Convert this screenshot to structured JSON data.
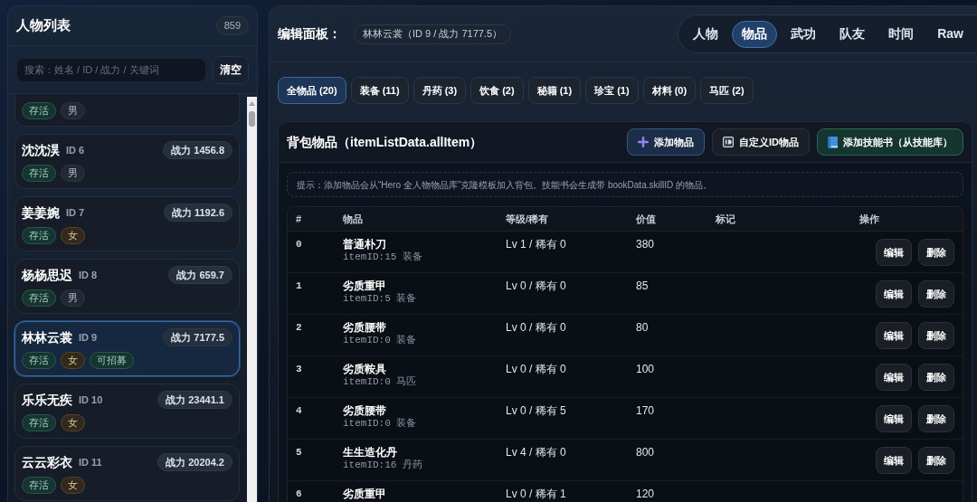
{
  "sidebar": {
    "title": "人物列表",
    "count": "859",
    "search": {
      "placeholder": "搜索：姓名 / ID / 战力 / 关键词"
    },
    "clear_button": "清空",
    "characters": [
      {
        "selected": false,
        "tags": [
          {
            "label": "存活",
            "kind": "status"
          },
          {
            "label": "男",
            "kind": "male"
          }
        ]
      },
      {
        "name": "沈沈淏",
        "id": "ID 6",
        "power": "战力 1456.8",
        "selected": false,
        "tags": [
          {
            "label": "存活",
            "kind": "status"
          },
          {
            "label": "男",
            "kind": "male"
          }
        ]
      },
      {
        "name": "姜姜婉",
        "id": "ID 7",
        "power": "战力 1192.6",
        "selected": false,
        "tags": [
          {
            "label": "存活",
            "kind": "status"
          },
          {
            "label": "女",
            "kind": "female"
          }
        ]
      },
      {
        "name": "杨杨思迟",
        "id": "ID 8",
        "power": "战力 659.7",
        "selected": false,
        "tags": [
          {
            "label": "存活",
            "kind": "status"
          },
          {
            "label": "男",
            "kind": "male"
          }
        ]
      },
      {
        "name": "林林云裳",
        "id": "ID 9",
        "power": "战力 7177.5",
        "selected": true,
        "tags": [
          {
            "label": "存活",
            "kind": "status"
          },
          {
            "label": "女",
            "kind": "female"
          },
          {
            "label": "可招募",
            "kind": "status"
          }
        ]
      },
      {
        "name": "乐乐无疾",
        "id": "ID 10",
        "power": "战力 23441.1",
        "selected": false,
        "tags": [
          {
            "label": "存活",
            "kind": "status"
          },
          {
            "label": "女",
            "kind": "female"
          }
        ]
      },
      {
        "name": "云云彩衣",
        "id": "ID 11",
        "power": "战力 20204.2",
        "selected": false,
        "tags": [
          {
            "label": "存活",
            "kind": "status"
          },
          {
            "label": "女",
            "kind": "female"
          }
        ]
      }
    ]
  },
  "editor": {
    "title": "编辑面板：",
    "current": "林林云裳（ID 9 / 战力 7177.5）",
    "tabs": [
      {
        "label": "人物",
        "selected": false
      },
      {
        "label": "物品",
        "selected": true
      },
      {
        "label": "武功",
        "selected": false
      },
      {
        "label": "队友",
        "selected": false
      },
      {
        "label": "时间",
        "selected": false
      },
      {
        "label": "Raw",
        "selected": false
      }
    ],
    "categories": [
      {
        "label": "全物品 (20)",
        "selected": true
      },
      {
        "label": "装备 (11)",
        "selected": false
      },
      {
        "label": "丹药 (3)",
        "selected": false
      },
      {
        "label": "饮食 (2)",
        "selected": false
      },
      {
        "label": "秘籍 (1)",
        "selected": false
      },
      {
        "label": "珍宝 (1)",
        "selected": false
      },
      {
        "label": "材料 (0)",
        "selected": false
      },
      {
        "label": "马匹 (2)",
        "selected": false
      }
    ],
    "backpack": {
      "title": "背包物品（itemListData.allItem）",
      "buttons": [
        {
          "label": "添加物品",
          "kind": "add"
        },
        {
          "label": "自定义ID物品",
          "kind": "custom"
        },
        {
          "label": "添加技能书（从技能库）",
          "kind": "book"
        }
      ],
      "hint": "提示：添加物品会从“Hero 全人物物品库”克隆模板加入背包。技能书会生成带 bookData.skillID 的物品。",
      "table": {
        "columns": [
          "#",
          "物品",
          "等级/稀有",
          "价值",
          "标记",
          "操作"
        ],
        "rows": [
          {
            "index": "0",
            "name": "普通朴刀",
            "sub": "itemID:15 装备",
            "level": "Lv 1 / 稀有 0",
            "value": "380",
            "actions": [
              "编辑",
              "删除"
            ]
          },
          {
            "index": "1",
            "name": "劣质重甲",
            "sub": "itemID:5 装备",
            "level": "Lv 0 / 稀有 0",
            "value": "85",
            "actions": [
              "编辑",
              "删除"
            ]
          },
          {
            "index": "2",
            "name": "劣质腰带",
            "sub": "itemID:0 装备",
            "level": "Lv 0 / 稀有 0",
            "value": "80",
            "actions": [
              "编辑",
              "删除"
            ]
          },
          {
            "index": "3",
            "name": "劣质鞍具",
            "sub": "itemID:0 马匹",
            "level": "Lv 0 / 稀有 0",
            "value": "100",
            "actions": [
              "编辑",
              "删除"
            ]
          },
          {
            "index": "4",
            "name": "劣质腰带",
            "sub": "itemID:0 装备",
            "level": "Lv 0 / 稀有 5",
            "value": "170",
            "actions": [
              "编辑",
              "删除"
            ]
          },
          {
            "index": "5",
            "name": "生生造化丹",
            "sub": "itemID:16 丹药",
            "level": "Lv 4 / 稀有 0",
            "value": "800",
            "actions": [
              "编辑",
              "删除"
            ]
          },
          {
            "index": "6",
            "name": "劣质重甲",
            "level": "Lv 0 / 稀有 1",
            "value": "120"
          }
        ]
      }
    }
  }
}
